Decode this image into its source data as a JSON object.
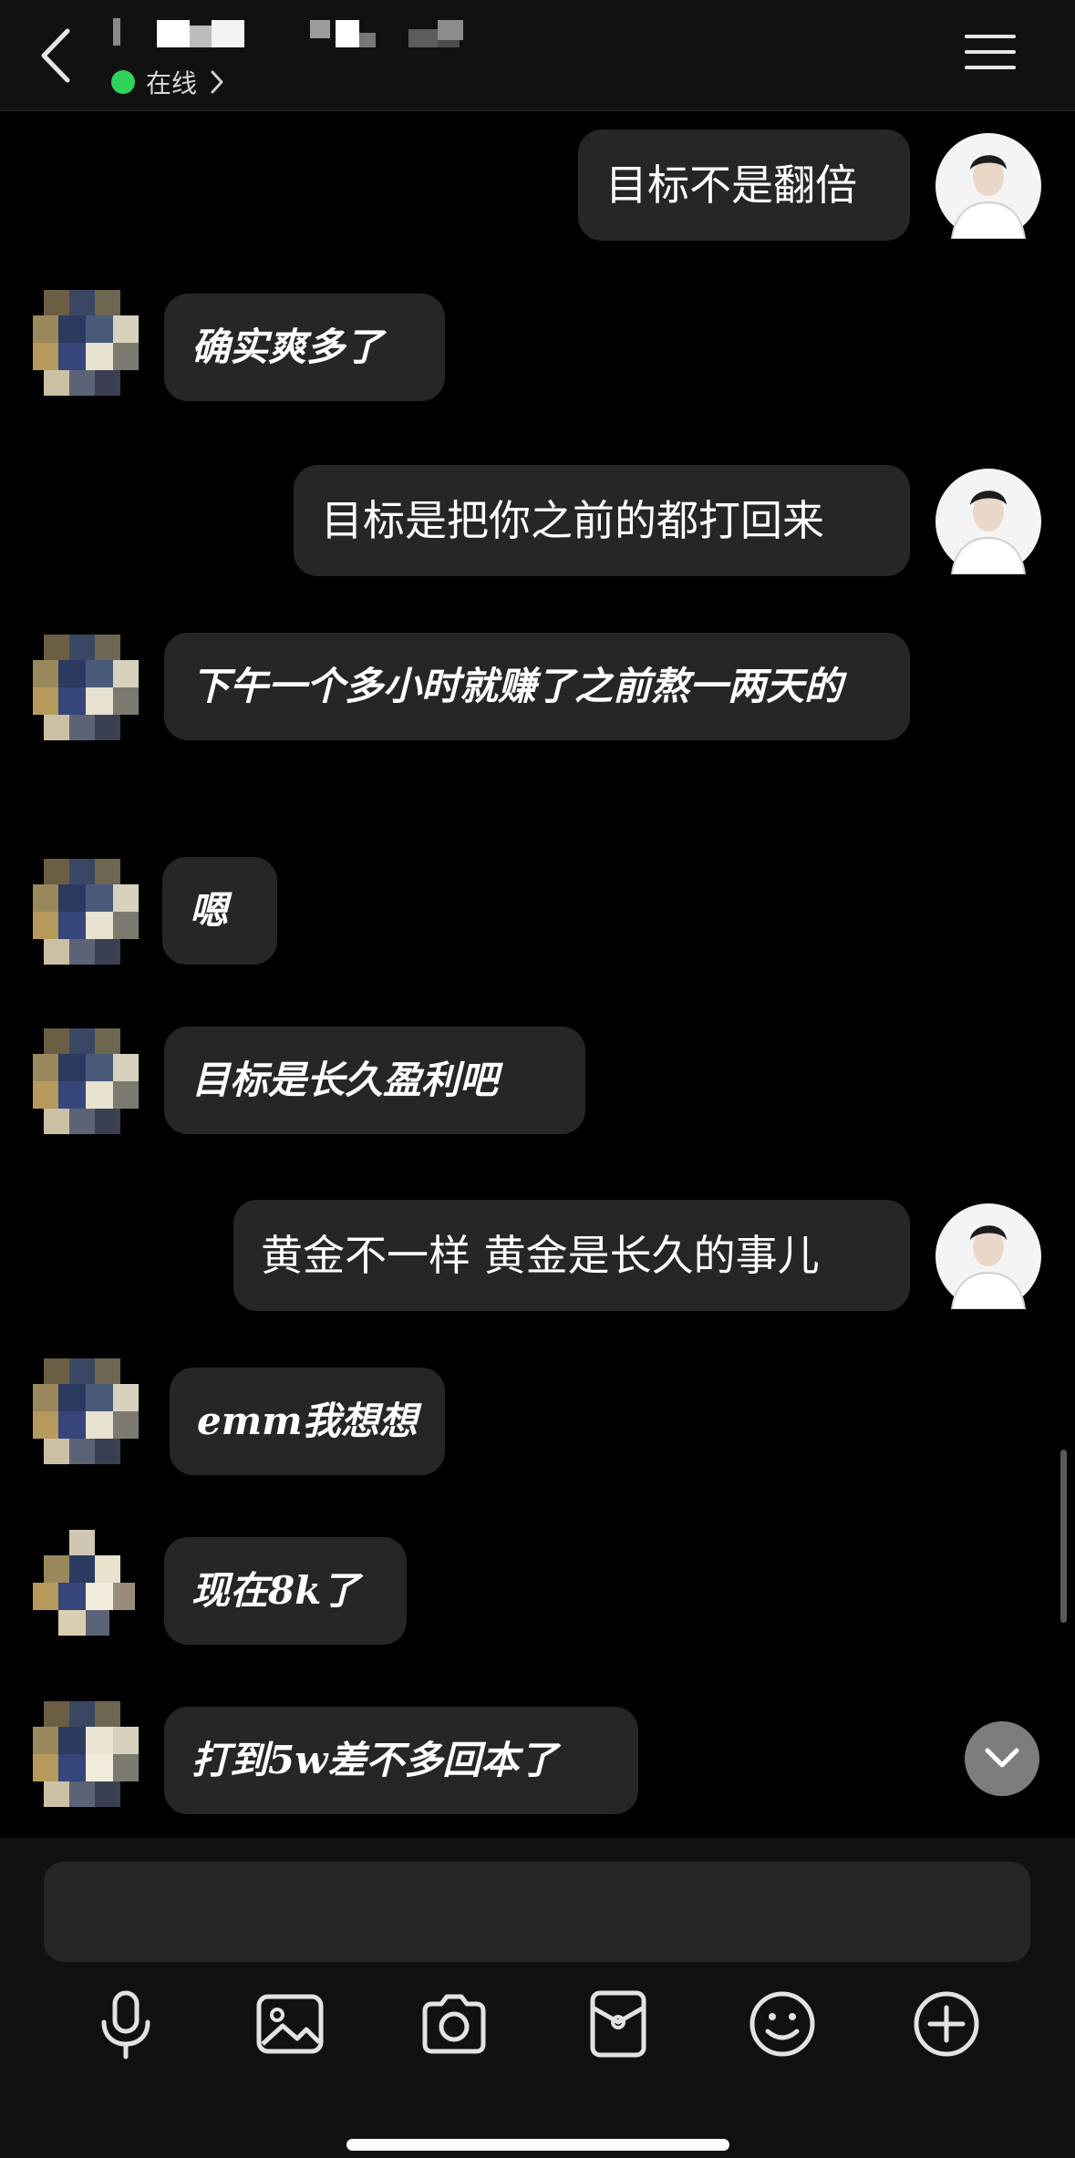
{
  "header": {
    "status_label": "在线",
    "status_color": "#2fd35c"
  },
  "messages": [
    {
      "side": "me",
      "text": "目标不是翻倍"
    },
    {
      "side": "them",
      "text": "确实爽多了"
    },
    {
      "side": "me",
      "text": "目标是把你之前的都打回来"
    },
    {
      "side": "them",
      "text": "下午一个多小时就赚了之前熬一两天的"
    },
    {
      "side": "them",
      "text": "嗯"
    },
    {
      "side": "them",
      "text": "目标是长久盈利吧"
    },
    {
      "side": "me",
      "text": "黄金不一样 黄金是长久的事儿"
    },
    {
      "side": "them",
      "text": "emm我想想"
    },
    {
      "side": "them",
      "text": "现在8k了"
    },
    {
      "side": "them",
      "text": "打到5w差不多回本了"
    }
  ],
  "input": {
    "value": "",
    "placeholder": ""
  },
  "toolbar": {
    "icons": [
      "microphone-icon",
      "image-icon",
      "camera-icon",
      "red-packet-icon",
      "emoji-icon",
      "plus-icon"
    ]
  },
  "colors": {
    "background": "#000000",
    "bar": "#111111",
    "bubble": "#262626",
    "text": "#ffffff"
  }
}
